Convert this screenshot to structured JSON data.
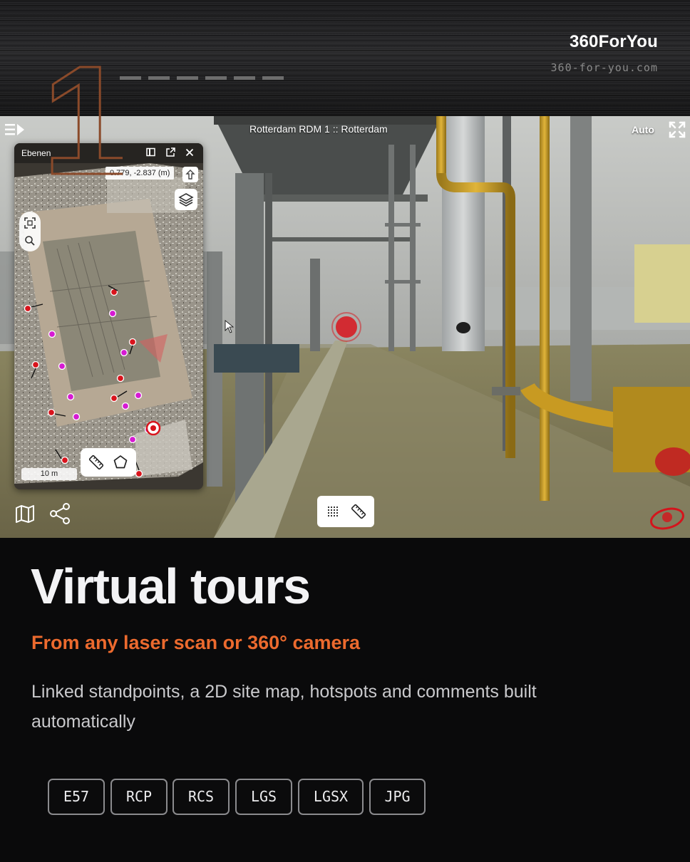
{
  "header": {
    "brand_name": "360ForYou",
    "brand_url": "360-for-you.com",
    "step_number": "1"
  },
  "viewer": {
    "title": "Rotterdam RDM 1 :: Rotterdam",
    "auto_label": "Auto",
    "map_panel": {
      "title": "Ebenen",
      "coordinates": "0.779, -2.837 (m)",
      "scale": "10 m"
    },
    "icons": {
      "menu": "menu-toggle-icon",
      "fullscreen": "fullscreen-icon",
      "layers": "layers-icon",
      "map": "map-icon",
      "share": "share-icon",
      "measure": "ruler-icon",
      "area": "pentagon-icon",
      "grid": "grid-icon"
    },
    "colors": {
      "standpoint_red": "#d8141c",
      "standpoint_magenta": "#d61ad2",
      "accent": "#ec6a2e"
    }
  },
  "content": {
    "headline": "Virtual tours",
    "subheadline": "From any laser scan or 360° camera",
    "description": "Linked standpoints, a 2D site map, hotspots and comments built automatically",
    "formats": [
      "E57",
      "RCP",
      "RCS",
      "LGS",
      "LGSX",
      "JPG"
    ]
  }
}
